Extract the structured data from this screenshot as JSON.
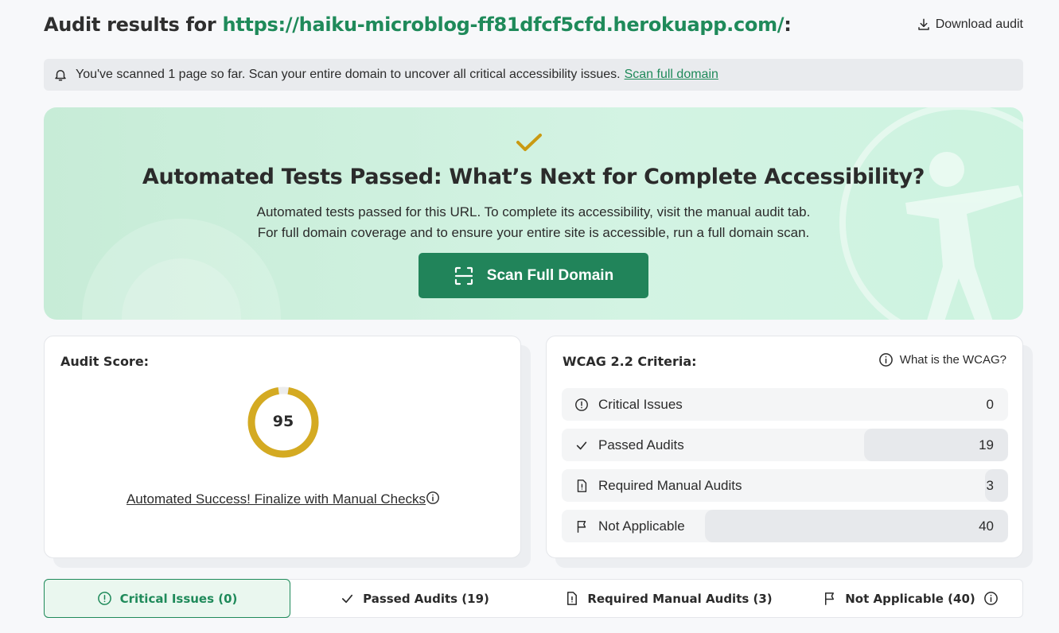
{
  "header": {
    "title_prefix": "Audit results for ",
    "url": "https://haiku-microblog-ff81dfcf5cfd.herokuapp.com/",
    "title_suffix": ":",
    "download_label": "Download audit"
  },
  "notice": {
    "text": "You've scanned 1 page so far. Scan your entire domain to uncover all critical accessibility issues.",
    "link": "Scan full domain"
  },
  "hero": {
    "title": "Automated Tests Passed: What’s Next for Complete Accessibility?",
    "line1": "Automated tests passed for this URL. To complete its accessibility, visit the manual audit tab.",
    "line2": "For full domain coverage and to ensure your entire site is accessible, run a full domain scan.",
    "button": "Scan Full Domain"
  },
  "score_card": {
    "title": "Audit Score:",
    "score": "95",
    "score_fraction": 0.95,
    "link_text": "Automated Success! Finalize with Manual Checks"
  },
  "wcag_card": {
    "title": "WCAG 2.2 Criteria:",
    "help": "What is the WCAG?",
    "rows": [
      {
        "label": "Critical Issues",
        "count": "0",
        "icon": "alert-circle-icon"
      },
      {
        "label": "Passed Audits",
        "count": "19",
        "icon": "check-icon"
      },
      {
        "label": "Required Manual Audits",
        "count": "3",
        "icon": "document-alert-icon"
      },
      {
        "label": "Not Applicable",
        "count": "40",
        "icon": "flag-icon"
      }
    ]
  },
  "tabs": [
    {
      "label": "Critical Issues (0)",
      "icon": "alert-circle-icon"
    },
    {
      "label": "Passed Audits (19)",
      "icon": "check-icon"
    },
    {
      "label": "Required Manual Audits (3)",
      "icon": "document-alert-icon"
    },
    {
      "label": "Not Applicable (40)",
      "icon": "flag-icon"
    }
  ],
  "colors": {
    "brand_green": "#1f8a5a",
    "button_green": "#21845a",
    "gauge_gold": "#d4aa22",
    "check_gold": "#c99a12"
  }
}
